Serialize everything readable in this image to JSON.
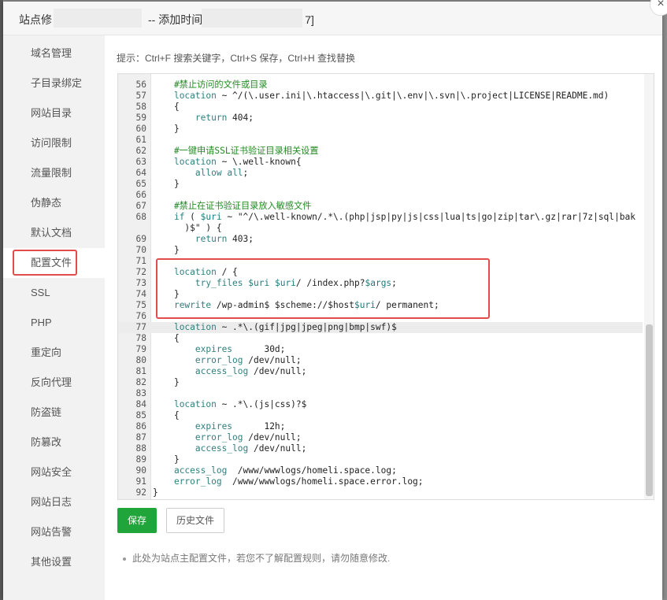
{
  "dialog": {
    "title_prefix": "站点修",
    "title_middle": "-- 添加时间",
    "title_suffix": "7]",
    "close_label": "×"
  },
  "sidebar": {
    "items": [
      {
        "label": "域名管理"
      },
      {
        "label": "子目录绑定"
      },
      {
        "label": "网站目录"
      },
      {
        "label": "访问限制"
      },
      {
        "label": "流量限制"
      },
      {
        "label": "伪静态"
      },
      {
        "label": "默认文档"
      },
      {
        "label": "配置文件"
      },
      {
        "label": "SSL"
      },
      {
        "label": "PHP"
      },
      {
        "label": "重定向"
      },
      {
        "label": "反向代理"
      },
      {
        "label": "防盗链"
      },
      {
        "label": "防篡改"
      },
      {
        "label": "网站安全"
      },
      {
        "label": "网站日志"
      },
      {
        "label": "网站告警"
      },
      {
        "label": "其他设置"
      }
    ],
    "active_index": 7
  },
  "editor": {
    "hint": "提示：Ctrl+F 搜索关键字，Ctrl+S 保存，Ctrl+H 查找替换",
    "lines": [
      {
        "n": "56",
        "t": "    #禁止访问的文件或目录"
      },
      {
        "n": "57",
        "t": "    location ~ ^/(\\.user.ini|\\.htaccess|\\.git|\\.env|\\.svn|\\.project|LICENSE|README.md)"
      },
      {
        "n": "58",
        "t": "    {"
      },
      {
        "n": "59",
        "t": "        return 404;"
      },
      {
        "n": "60",
        "t": "    }"
      },
      {
        "n": "61",
        "t": ""
      },
      {
        "n": "62",
        "t": "    #一键申请SSL证书验证目录相关设置"
      },
      {
        "n": "63",
        "t": "    location ~ \\.well-known{"
      },
      {
        "n": "64",
        "t": "        allow all;"
      },
      {
        "n": "65",
        "t": "    }"
      },
      {
        "n": "66",
        "t": ""
      },
      {
        "n": "67",
        "t": "    #禁止在证书验证目录放入敏感文件"
      },
      {
        "n": "68",
        "t": "    if ( $uri ~ \"^/\\.well-known/.*\\.(php|jsp|py|js|css|lua|ts|go|zip|tar\\.gz|rar|7z|sql|bak"
      },
      {
        "n": "",
        "t": "      )$\" ) {"
      },
      {
        "n": "69",
        "t": "        return 403;"
      },
      {
        "n": "70",
        "t": "    }"
      },
      {
        "n": "71",
        "t": ""
      },
      {
        "n": "72",
        "t": "    location / {"
      },
      {
        "n": "73",
        "t": "        try_files $uri $uri/ /index.php?$args;"
      },
      {
        "n": "74",
        "t": "    }"
      },
      {
        "n": "75",
        "t": "    rewrite /wp-admin$ $scheme://$host$uri/ permanent;"
      },
      {
        "n": "76",
        "t": ""
      },
      {
        "n": "77",
        "t": "    location ~ .*\\.(gif|jpg|jpeg|png|bmp|swf)$"
      },
      {
        "n": "78",
        "t": "    {"
      },
      {
        "n": "79",
        "t": "        expires      30d;"
      },
      {
        "n": "80",
        "t": "        error_log /dev/null;"
      },
      {
        "n": "81",
        "t": "        access_log /dev/null;"
      },
      {
        "n": "82",
        "t": "    }"
      },
      {
        "n": "83",
        "t": ""
      },
      {
        "n": "84",
        "t": "    location ~ .*\\.(js|css)?$"
      },
      {
        "n": "85",
        "t": "    {"
      },
      {
        "n": "86",
        "t": "        expires      12h;"
      },
      {
        "n": "87",
        "t": "        error_log /dev/null;"
      },
      {
        "n": "88",
        "t": "        access_log /dev/null;"
      },
      {
        "n": "89",
        "t": "    }"
      },
      {
        "n": "90",
        "t": "    access_log  /www/wwwlogs/homeli.space.log;"
      },
      {
        "n": "91",
        "t": "    error_log  /www/wwwlogs/homeli.space.error.log;"
      },
      {
        "n": "92",
        "t": "}"
      }
    ],
    "current_line": "77"
  },
  "buttons": {
    "save_label": "保存",
    "history_label": "历史文件"
  },
  "note": "此处为站点主配置文件，若您不了解配置规则，请勿随意修改.",
  "colors": {
    "save_button": "#20a53a",
    "highlight_border": "#e14c4c",
    "comment": "#238a23",
    "keyword": "#2f7f7f"
  }
}
